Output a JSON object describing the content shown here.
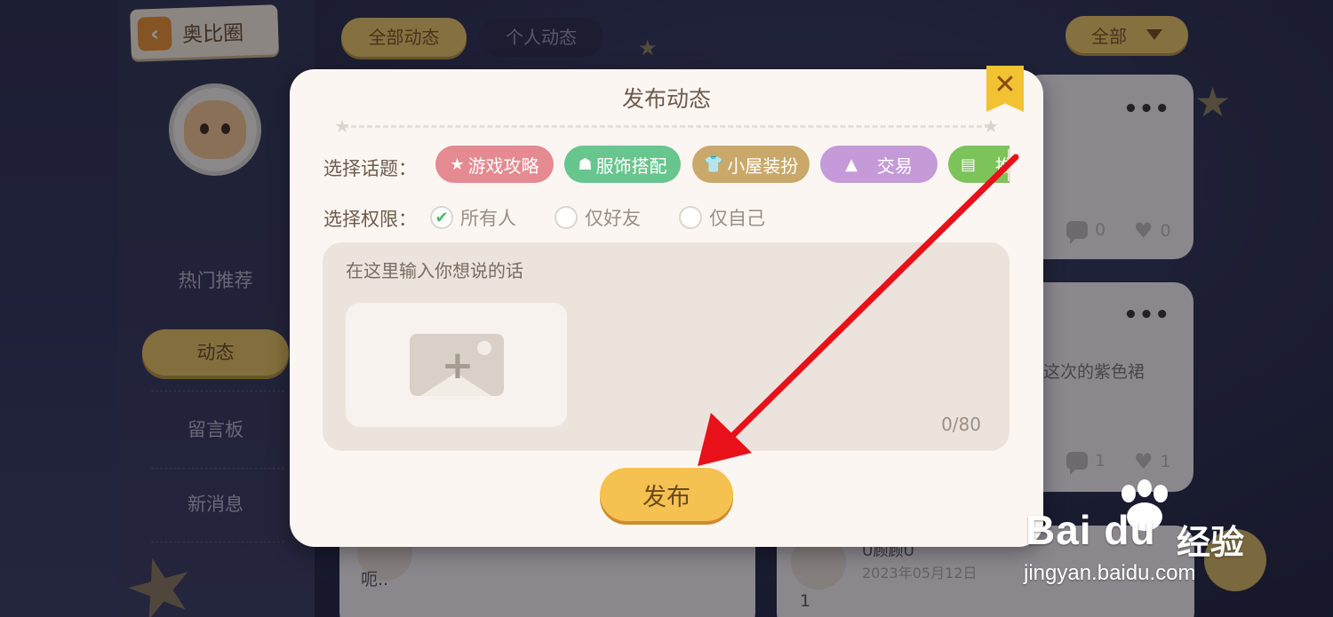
{
  "sidebar": {
    "back_label": "奥比圈",
    "items": [
      {
        "label": "热门推荐"
      },
      {
        "label": "动态"
      },
      {
        "label": "留言板"
      },
      {
        "label": "新消息"
      }
    ]
  },
  "feed": {
    "tabs": [
      "全部动态",
      "个人动态"
    ],
    "filter_label": "全部",
    "posts": [
      {
        "more": "•••",
        "comments": "0",
        "likes": "0"
      },
      {
        "more": "•••",
        "text": "这次的紫色裙",
        "comments": "1",
        "likes": "1"
      },
      {
        "text": "呃.."
      },
      {
        "name": "U顾顾U",
        "date": "2023年05月12日",
        "text": "1"
      }
    ]
  },
  "modal": {
    "title": "发布动态",
    "close": "✕",
    "topic_label": "选择话题：",
    "topics": [
      {
        "label": "游戏攻略",
        "icon": "★",
        "color": "#e58a91"
      },
      {
        "label": "服饰搭配",
        "icon": "☗",
        "color": "#67c58e"
      },
      {
        "label": "小屋装扮",
        "icon": "👕",
        "color": "#c9a869"
      },
      {
        "label": "交易",
        "icon": "▲",
        "color": "#c59ad9"
      },
      {
        "label": "推",
        "icon": "▤",
        "color": "#7cc35a"
      }
    ],
    "permission_label": "选择权限：",
    "permissions": [
      {
        "label": "所有人",
        "checked": true
      },
      {
        "label": "仅好友",
        "checked": false
      },
      {
        "label": "仅自己",
        "checked": false
      }
    ],
    "input_placeholder": "在这里输入你想说的话",
    "counter": "0/80",
    "publish_label": "发布"
  },
  "watermark": {
    "logo": "Bai du",
    "sub": "经验",
    "url": "jingyan.baidu.com"
  },
  "colors": {
    "accent_gold": "#e9c462",
    "arrow_red": "#e8111a"
  }
}
